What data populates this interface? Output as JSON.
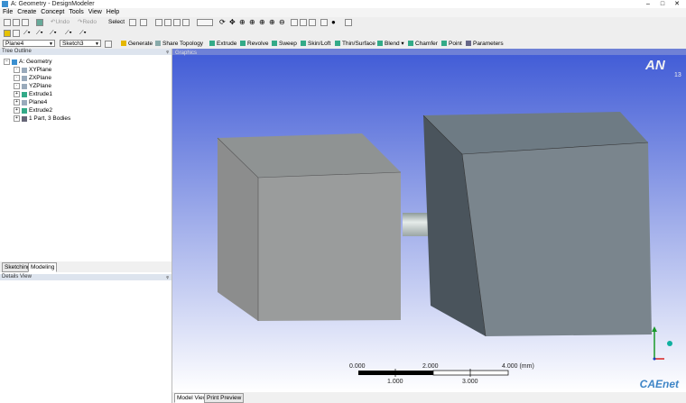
{
  "window": {
    "title": "A: Geometry - DesignModeler"
  },
  "menu": [
    "File",
    "Create",
    "Concept",
    "Tools",
    "View",
    "Help"
  ],
  "toolbar1": {
    "undo": "Undo",
    "redo": "Redo",
    "select": "Select"
  },
  "toolbar3": {
    "plane": "Plane4",
    "sketch": "Sketch3",
    "generate": "Generate",
    "share_topology": "Share Topology",
    "extrude": "Extrude",
    "revolve": "Revolve",
    "sweep": "Sweep",
    "skin_loft": "Skin/Loft",
    "thin_surface": "Thin/Surface",
    "blend": "Blend",
    "chamfer": "Chamfer",
    "point": "Point",
    "parameters": "Parameters"
  },
  "tree": {
    "header": "Tree Outline",
    "root": "A: Geometry",
    "items": [
      "XYPlane",
      "ZXPlane",
      "YZPlane",
      "Extrude1",
      "Plane4",
      "Extrude2",
      "1 Part, 3 Bodies"
    ]
  },
  "mode_tabs": [
    "Sketching",
    "Modeling"
  ],
  "detail": {
    "header": "Details View"
  },
  "viewport": {
    "header": "Graphics",
    "logo": "AN",
    "version": "13",
    "scale": {
      "ticks_top": [
        "0.000",
        "2.000",
        "4.000 (mm)"
      ],
      "ticks_bottom": [
        "1.000",
        "3.000"
      ]
    }
  },
  "view_tabs": [
    "Model View",
    "Print Preview"
  ],
  "watermark": "CAEnet",
  "colors": {
    "accent": "#3f86c7",
    "viewport_top": "#3f5ad6",
    "viewport_bottom": "#ffffff"
  }
}
